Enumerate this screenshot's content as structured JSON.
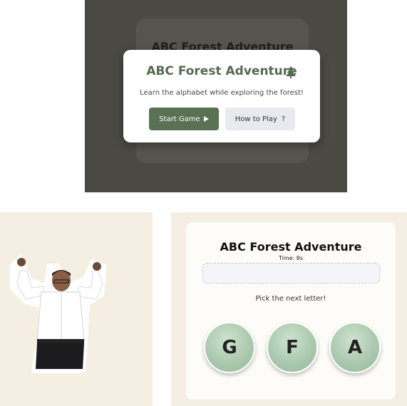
{
  "start_screen": {
    "background_card_title": "ABC Forest Adventure",
    "modal": {
      "title": "ABC Forest Adventure",
      "subtitle": "Learn the alphabet while exploring the forest!",
      "start_button": "Start Game",
      "howto_button": "How to Play",
      "howto_icon": "?"
    }
  },
  "game": {
    "title": "ABC Forest Adventure",
    "time_label": "Time:",
    "time_value": "8s",
    "prompt": "Pick the next letter!",
    "letters": [
      "G",
      "F",
      "A"
    ]
  },
  "colors": {
    "accent_green": "#5a7253",
    "letter_green": "#a8c7ac",
    "cream_background": "#f4efe2",
    "overlay": "#4a4943"
  }
}
